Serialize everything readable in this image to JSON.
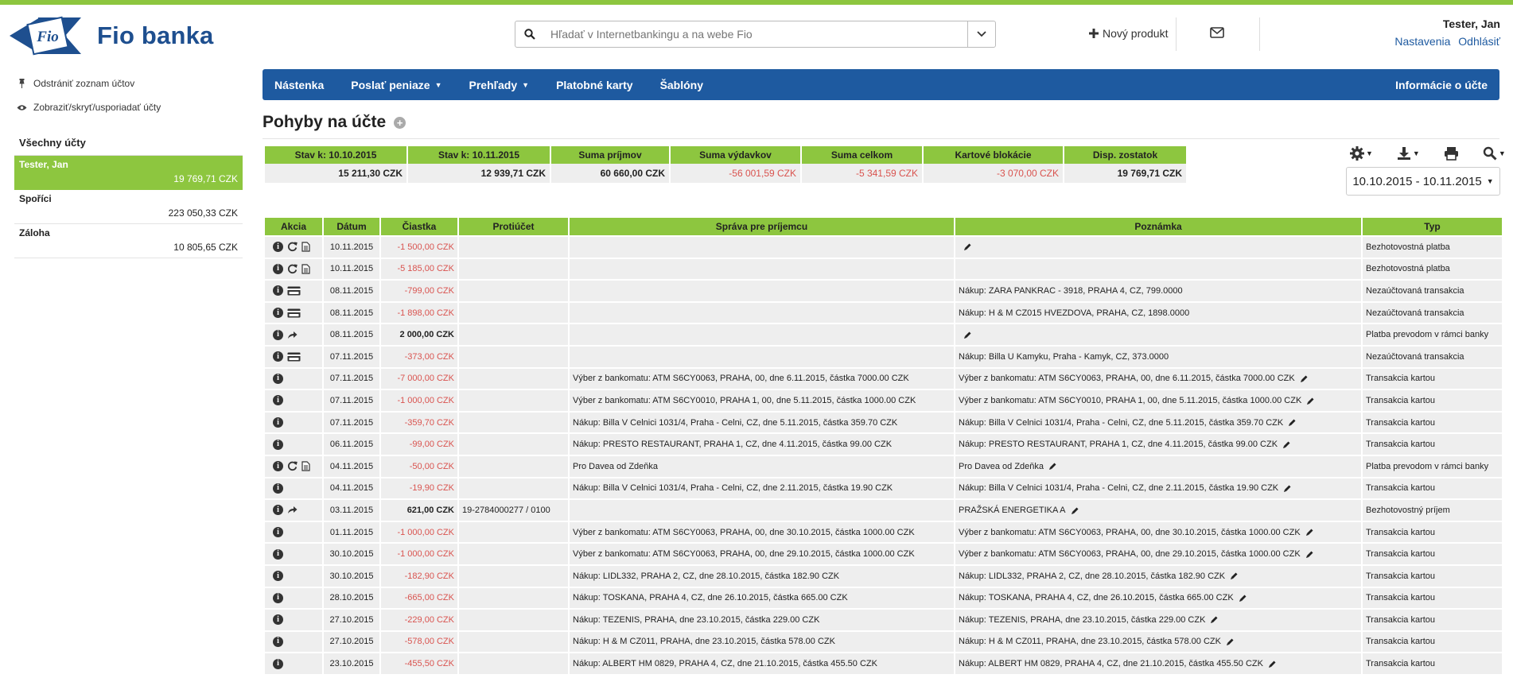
{
  "brand": {
    "name": "Fio banka",
    "mark": "Fio",
    "accent": "#8dc63f",
    "primary": "#1e5aa0"
  },
  "search": {
    "placeholder": "Hľadať v Internetbankingu a na webe Fio"
  },
  "header": {
    "new_product": "Nový produkt",
    "user_name": "Tester, Jan",
    "settings": "Nastavenia",
    "logout": "Odhlásiť"
  },
  "sidebar": {
    "remove_list": "Odstrániť zoznam účtov",
    "show_hide": "Zobraziť/skryť/usporiadať účty",
    "all_accounts": "Všechny účty",
    "accounts": [
      {
        "name": "Tester, Jan",
        "balance": "19 769,71 CZK"
      },
      {
        "name": "Spoříci",
        "balance": "223 050,33 CZK"
      },
      {
        "name": "Záloha",
        "balance": "10 805,65 CZK"
      }
    ]
  },
  "nav": {
    "items": [
      "Nástenka",
      "Poslať peniaze",
      "Prehľady",
      "Platobné karty",
      "Šablóny"
    ],
    "right": "Informácie o účte"
  },
  "page": {
    "title": "Pohyby na účte"
  },
  "summary": {
    "headers": [
      "Stav k: 10.10.2015",
      "Stav k: 10.11.2015",
      "Suma príjmov",
      "Suma výdavkov",
      "Suma celkom",
      "Kartové blokácie",
      "Disp. zostatok"
    ],
    "values": [
      "15 211,30 CZK",
      "12 939,71 CZK",
      "60 660,00 CZK",
      "-56 001,59 CZK",
      "-5 341,59 CZK",
      "-3 070,00 CZK",
      "19 769,71 CZK"
    ]
  },
  "date_range": "10.10.2015 - 10.11.2015",
  "table": {
    "headers": [
      "Akcia",
      "Dátum",
      "Čiastka",
      "Protiúčet",
      "Správa pre príjemcu",
      "Poznámka",
      "Typ"
    ],
    "rows": [
      {
        "icons": [
          "info",
          "repeat",
          "doc"
        ],
        "date": "10.11.2015",
        "amount": "-1 500,00 CZK",
        "neg": true,
        "counter": "",
        "message": "",
        "note": "",
        "pencil": true,
        "type": "Bezhotovostná platba"
      },
      {
        "icons": [
          "info",
          "repeat",
          "doc"
        ],
        "date": "10.11.2015",
        "amount": "-5 185,00 CZK",
        "neg": true,
        "counter": "",
        "message": "",
        "note": "",
        "pencil": false,
        "type": "Bezhotovostná platba"
      },
      {
        "icons": [
          "info",
          "card"
        ],
        "date": "08.11.2015",
        "amount": "-799,00 CZK",
        "neg": true,
        "counter": "",
        "message": "",
        "note": "Nákup: ZARA PANKRAC - 3918, PRAHA 4, CZ, 799.0000",
        "pencil": false,
        "type": "Nezaúčtovaná transakcia"
      },
      {
        "icons": [
          "info",
          "card"
        ],
        "date": "08.11.2015",
        "amount": "-1 898,00 CZK",
        "neg": true,
        "counter": "",
        "message": "",
        "note": "Nákup: H & M CZ015 HVEZDOVA, PRAHA, CZ, 1898.0000",
        "pencil": false,
        "type": "Nezaúčtovaná transakcia"
      },
      {
        "icons": [
          "info",
          "share"
        ],
        "date": "08.11.2015",
        "amount": "2 000,00 CZK",
        "neg": false,
        "counter": "",
        "message": "",
        "note": "",
        "pencil": true,
        "type": "Platba prevodom v rámci banky"
      },
      {
        "icons": [
          "info",
          "card"
        ],
        "date": "07.11.2015",
        "amount": "-373,00 CZK",
        "neg": true,
        "counter": "",
        "message": "",
        "note": "Nákup: Billa U Kamyku, Praha - Kamyk, CZ, 373.0000",
        "pencil": false,
        "type": "Nezaúčtovaná transakcia"
      },
      {
        "icons": [
          "info"
        ],
        "date": "07.11.2015",
        "amount": "-7 000,00 CZK",
        "neg": true,
        "counter": "",
        "message": "Výber z bankomatu: ATM S6CY0063, PRAHA, 00, dne 6.11.2015, částka 7000.00 CZK",
        "note": "Výber z bankomatu: ATM S6CY0063, PRAHA, 00, dne 6.11.2015, částka 7000.00 CZK",
        "pencil": true,
        "type": "Transakcia kartou"
      },
      {
        "icons": [
          "info"
        ],
        "date": "07.11.2015",
        "amount": "-1 000,00 CZK",
        "neg": true,
        "counter": "",
        "message": "Výber z bankomatu: ATM S6CY0010, PRAHA 1, 00, dne 5.11.2015, částka 1000.00 CZK",
        "note": "Výber z bankomatu: ATM S6CY0010, PRAHA 1, 00, dne 5.11.2015, částka 1000.00 CZK",
        "pencil": true,
        "type": "Transakcia kartou"
      },
      {
        "icons": [
          "info"
        ],
        "date": "07.11.2015",
        "amount": "-359,70 CZK",
        "neg": true,
        "counter": "",
        "message": "Nákup: Billa V Celnici 1031/4, Praha - Celni, CZ, dne 5.11.2015, částka 359.70 CZK",
        "note": "Nákup: Billa V Celnici 1031/4, Praha - Celni, CZ, dne 5.11.2015, částka 359.70 CZK",
        "pencil": true,
        "type": "Transakcia kartou"
      },
      {
        "icons": [
          "info"
        ],
        "date": "06.11.2015",
        "amount": "-99,00 CZK",
        "neg": true,
        "counter": "",
        "message": "Nákup: PRESTO RESTAURANT, PRAHA 1, CZ, dne 4.11.2015, částka 99.00 CZK",
        "note": "Nákup: PRESTO RESTAURANT, PRAHA 1, CZ, dne 4.11.2015, částka 99.00 CZK",
        "pencil": true,
        "type": "Transakcia kartou"
      },
      {
        "icons": [
          "info",
          "repeat",
          "doc"
        ],
        "date": "04.11.2015",
        "amount": "-50,00 CZK",
        "neg": true,
        "counter": "",
        "message": "Pro Davea od Zdeňka",
        "note": "Pro Davea od Zdeňka",
        "pencil": true,
        "type": "Platba prevodom v rámci banky"
      },
      {
        "icons": [
          "info"
        ],
        "date": "04.11.2015",
        "amount": "-19,90 CZK",
        "neg": true,
        "counter": "",
        "message": "Nákup: Billa V Celnici 1031/4, Praha - Celni, CZ, dne 2.11.2015, částka 19.90 CZK",
        "note": "Nákup: Billa V Celnici 1031/4, Praha - Celni, CZ, dne 2.11.2015, částka 19.90 CZK",
        "pencil": true,
        "type": "Transakcia kartou"
      },
      {
        "icons": [
          "info",
          "share"
        ],
        "date": "03.11.2015",
        "amount": "621,00 CZK",
        "neg": false,
        "counter": "19-2784000277 / 0100",
        "message": "",
        "note": "PRAŽSKÁ ENERGETIKA A",
        "pencil": true,
        "type": "Bezhotovostný príjem"
      },
      {
        "icons": [
          "info"
        ],
        "date": "01.11.2015",
        "amount": "-1 000,00 CZK",
        "neg": true,
        "counter": "",
        "message": "Výber z bankomatu: ATM S6CY0063, PRAHA, 00, dne 30.10.2015, částka 1000.00 CZK",
        "note": "Výber z bankomatu: ATM S6CY0063, PRAHA, 00, dne 30.10.2015, částka 1000.00 CZK",
        "pencil": true,
        "type": "Transakcia kartou"
      },
      {
        "icons": [
          "info"
        ],
        "date": "30.10.2015",
        "amount": "-1 000,00 CZK",
        "neg": true,
        "counter": "",
        "message": "Výber z bankomatu: ATM S6CY0063, PRAHA, 00, dne 29.10.2015, částka 1000.00 CZK",
        "note": "Výber z bankomatu: ATM S6CY0063, PRAHA, 00, dne 29.10.2015, částka 1000.00 CZK",
        "pencil": true,
        "type": "Transakcia kartou"
      },
      {
        "icons": [
          "info"
        ],
        "date": "30.10.2015",
        "amount": "-182,90 CZK",
        "neg": true,
        "counter": "",
        "message": "Nákup: LIDL332, PRAHA 2, CZ, dne 28.10.2015, částka 182.90 CZK",
        "note": "Nákup: LIDL332, PRAHA 2, CZ, dne 28.10.2015, částka 182.90 CZK",
        "pencil": true,
        "type": "Transakcia kartou"
      },
      {
        "icons": [
          "info"
        ],
        "date": "28.10.2015",
        "amount": "-665,00 CZK",
        "neg": true,
        "counter": "",
        "message": "Nákup: TOSKANA, PRAHA 4, CZ, dne 26.10.2015, částka 665.00 CZK",
        "note": "Nákup: TOSKANA, PRAHA 4, CZ, dne 26.10.2015, částka 665.00 CZK",
        "pencil": true,
        "type": "Transakcia kartou"
      },
      {
        "icons": [
          "info"
        ],
        "date": "27.10.2015",
        "amount": "-229,00 CZK",
        "neg": true,
        "counter": "",
        "message": "Nákup: TEZENIS, PRAHA, dne 23.10.2015, částka 229.00 CZK",
        "note": "Nákup: TEZENIS, PRAHA, dne 23.10.2015, částka 229.00 CZK",
        "pencil": true,
        "type": "Transakcia kartou"
      },
      {
        "icons": [
          "info"
        ],
        "date": "27.10.2015",
        "amount": "-578,00 CZK",
        "neg": true,
        "counter": "",
        "message": "Nákup: H & M CZ011, PRAHA, dne 23.10.2015, částka 578.00 CZK",
        "note": "Nákup: H & M CZ011, PRAHA, dne 23.10.2015, částka 578.00 CZK",
        "pencil": true,
        "type": "Transakcia kartou"
      },
      {
        "icons": [
          "info"
        ],
        "date": "23.10.2015",
        "amount": "-455,50 CZK",
        "neg": true,
        "counter": "",
        "message": "Nákup: ALBERT HM 0829, PRAHA 4, CZ, dne 21.10.2015, částka 455.50 CZK",
        "note": "Nákup: ALBERT HM 0829, PRAHA 4, CZ, dne 21.10.2015, částka 455.50 CZK",
        "pencil": true,
        "type": "Transakcia kartou"
      }
    ]
  }
}
